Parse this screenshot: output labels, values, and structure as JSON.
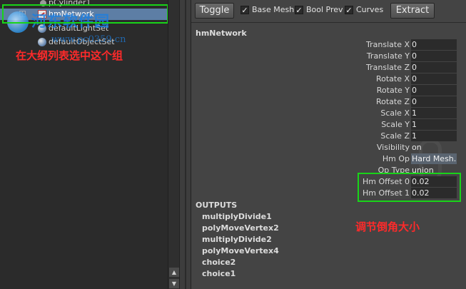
{
  "outliner": {
    "items": [
      {
        "label": "pCylinder1",
        "icon": "cylinder-icon"
      },
      {
        "label": "hmNetwork",
        "icon": "hm-network-icon",
        "selected": true
      },
      {
        "label": "defaultLightSet",
        "icon": "light-set-icon"
      },
      {
        "label": "defaultObjectSet",
        "icon": "object-set-icon"
      }
    ],
    "watermark": {
      "title": "河东软件园",
      "url": "www.pc0359.cn"
    },
    "annotation": "在大纲列表选中这个组"
  },
  "toolbar": {
    "toggle_label": "Toggle",
    "extract_label": "Extract",
    "checkboxes": [
      {
        "label": "Base Mesh",
        "checked": true
      },
      {
        "label": "Bool Prev",
        "checked": true
      },
      {
        "label": "Curves",
        "checked": true
      }
    ]
  },
  "attributes": {
    "node_name": "hmNetwork",
    "rows": [
      {
        "label": "Translate X",
        "value": "0"
      },
      {
        "label": "Translate Y",
        "value": "0"
      },
      {
        "label": "Translate Z",
        "value": "0"
      },
      {
        "label": "Rotate X",
        "value": "0"
      },
      {
        "label": "Rotate Y",
        "value": "0"
      },
      {
        "label": "Rotate Z",
        "value": "0"
      },
      {
        "label": "Scale X",
        "value": "1"
      },
      {
        "label": "Scale Y",
        "value": "1"
      },
      {
        "label": "Scale Z",
        "value": "1"
      },
      {
        "label": "Visibility",
        "value": "on"
      },
      {
        "label": "Hm Op",
        "value": "Hard Mesh..."
      },
      {
        "label": "Op Type",
        "value": "union"
      },
      {
        "label": "Hm Offset 0",
        "value": "0.02"
      },
      {
        "label": "Hm Offset 1",
        "value": "0.02"
      }
    ],
    "outputs_title": "OUTPUTS",
    "outputs": [
      "multiplyDivide1",
      "polyMoveVertex2",
      "multiplyDivide2",
      "polyMoveVertex4",
      "choice2",
      "choice1"
    ],
    "annotation": "调节倒角大小"
  },
  "colors": {
    "highlight_box": "#19d419",
    "annotation": "#ff2a2a",
    "selection": "#5d7ea5"
  }
}
